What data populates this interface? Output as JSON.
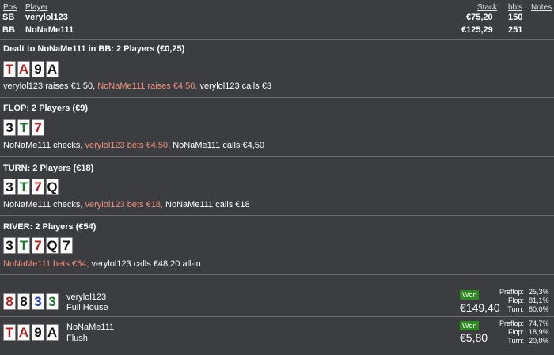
{
  "header": {
    "pos": "Pos",
    "player": "Player",
    "stack": "Stack",
    "bbs": "bb's",
    "notes": "Notes"
  },
  "players": [
    {
      "pos": "SB",
      "name": "verylol123",
      "stack": "€75,20",
      "bbs": "150"
    },
    {
      "pos": "BB",
      "name": "NoNaMe111",
      "stack": "€125,29",
      "bbs": "251"
    }
  ],
  "preflop": {
    "title": "Dealt to NoNaMe111 in BB: 2 Players (€0,25)",
    "cards": [
      {
        "rank": "T",
        "color": "red"
      },
      {
        "rank": "A",
        "color": "red"
      },
      {
        "rank": "9",
        "color": "black"
      },
      {
        "rank": "A",
        "color": "black"
      }
    ],
    "a1": "verylol123 raises €1,50, ",
    "a2": "NoNaMe111 raises €4,50, ",
    "a3": "verylol123 calls €3"
  },
  "flop": {
    "title": "FLOP: 2 Players (€9)",
    "cards": [
      {
        "rank": "3",
        "color": "black"
      },
      {
        "rank": "T",
        "color": "green"
      },
      {
        "rank": "7",
        "color": "red"
      }
    ],
    "a1": "NoNaMe111 checks, ",
    "a2": "verylol123 bets €4,50, ",
    "a3": "NoNaMe111 calls €4,50"
  },
  "turn": {
    "title": "TURN: 2 Players (€18)",
    "cards": [
      {
        "rank": "3",
        "color": "black"
      },
      {
        "rank": "T",
        "color": "green"
      },
      {
        "rank": "7",
        "color": "red"
      },
      {
        "rank": "Q",
        "color": "black"
      }
    ],
    "a1": "NoNaMe111 checks, ",
    "a2": "verylol123 bets €18, ",
    "a3": "NoNaMe111 calls €18"
  },
  "river": {
    "title": "RIVER: 2 Players (€54)",
    "cards": [
      {
        "rank": "3",
        "color": "black"
      },
      {
        "rank": "T",
        "color": "green"
      },
      {
        "rank": "7",
        "color": "red"
      },
      {
        "rank": "Q",
        "color": "black"
      },
      {
        "rank": "7",
        "color": "black"
      }
    ],
    "a1": "NoNaMe111 bets €54, ",
    "a2": "verylol123 calls €48,20 all-in"
  },
  "showdown": [
    {
      "name": "verylol123",
      "hand": "Full House",
      "won": "Won",
      "amount": "€149,40",
      "cards": [
        {
          "rank": "8",
          "color": "red"
        },
        {
          "rank": "8",
          "color": "black"
        },
        {
          "rank": "3",
          "color": "blue"
        },
        {
          "rank": "3",
          "color": "green"
        }
      ],
      "stats": [
        {
          "label": "Preflop:",
          "value": "25,3%"
        },
        {
          "label": "Flop:",
          "value": "81,1%"
        },
        {
          "label": "Turn:",
          "value": "80,0%"
        }
      ]
    },
    {
      "name": "NoNaMe111",
      "hand": "Flush",
      "won": "Won",
      "amount": "€5,80",
      "cards": [
        {
          "rank": "T",
          "color": "red"
        },
        {
          "rank": "A",
          "color": "red"
        },
        {
          "rank": "9",
          "color": "black"
        },
        {
          "rank": "A",
          "color": "black"
        }
      ],
      "stats": [
        {
          "label": "Preflop:",
          "value": "74,7%"
        },
        {
          "label": "Flop:",
          "value": "18,9%"
        },
        {
          "label": "Turn:",
          "value": "20,0%"
        }
      ]
    }
  ],
  "colors": {
    "background": "#3b3d41",
    "highlight": "#f08f7c",
    "won_badge": "#2d8a1e"
  }
}
